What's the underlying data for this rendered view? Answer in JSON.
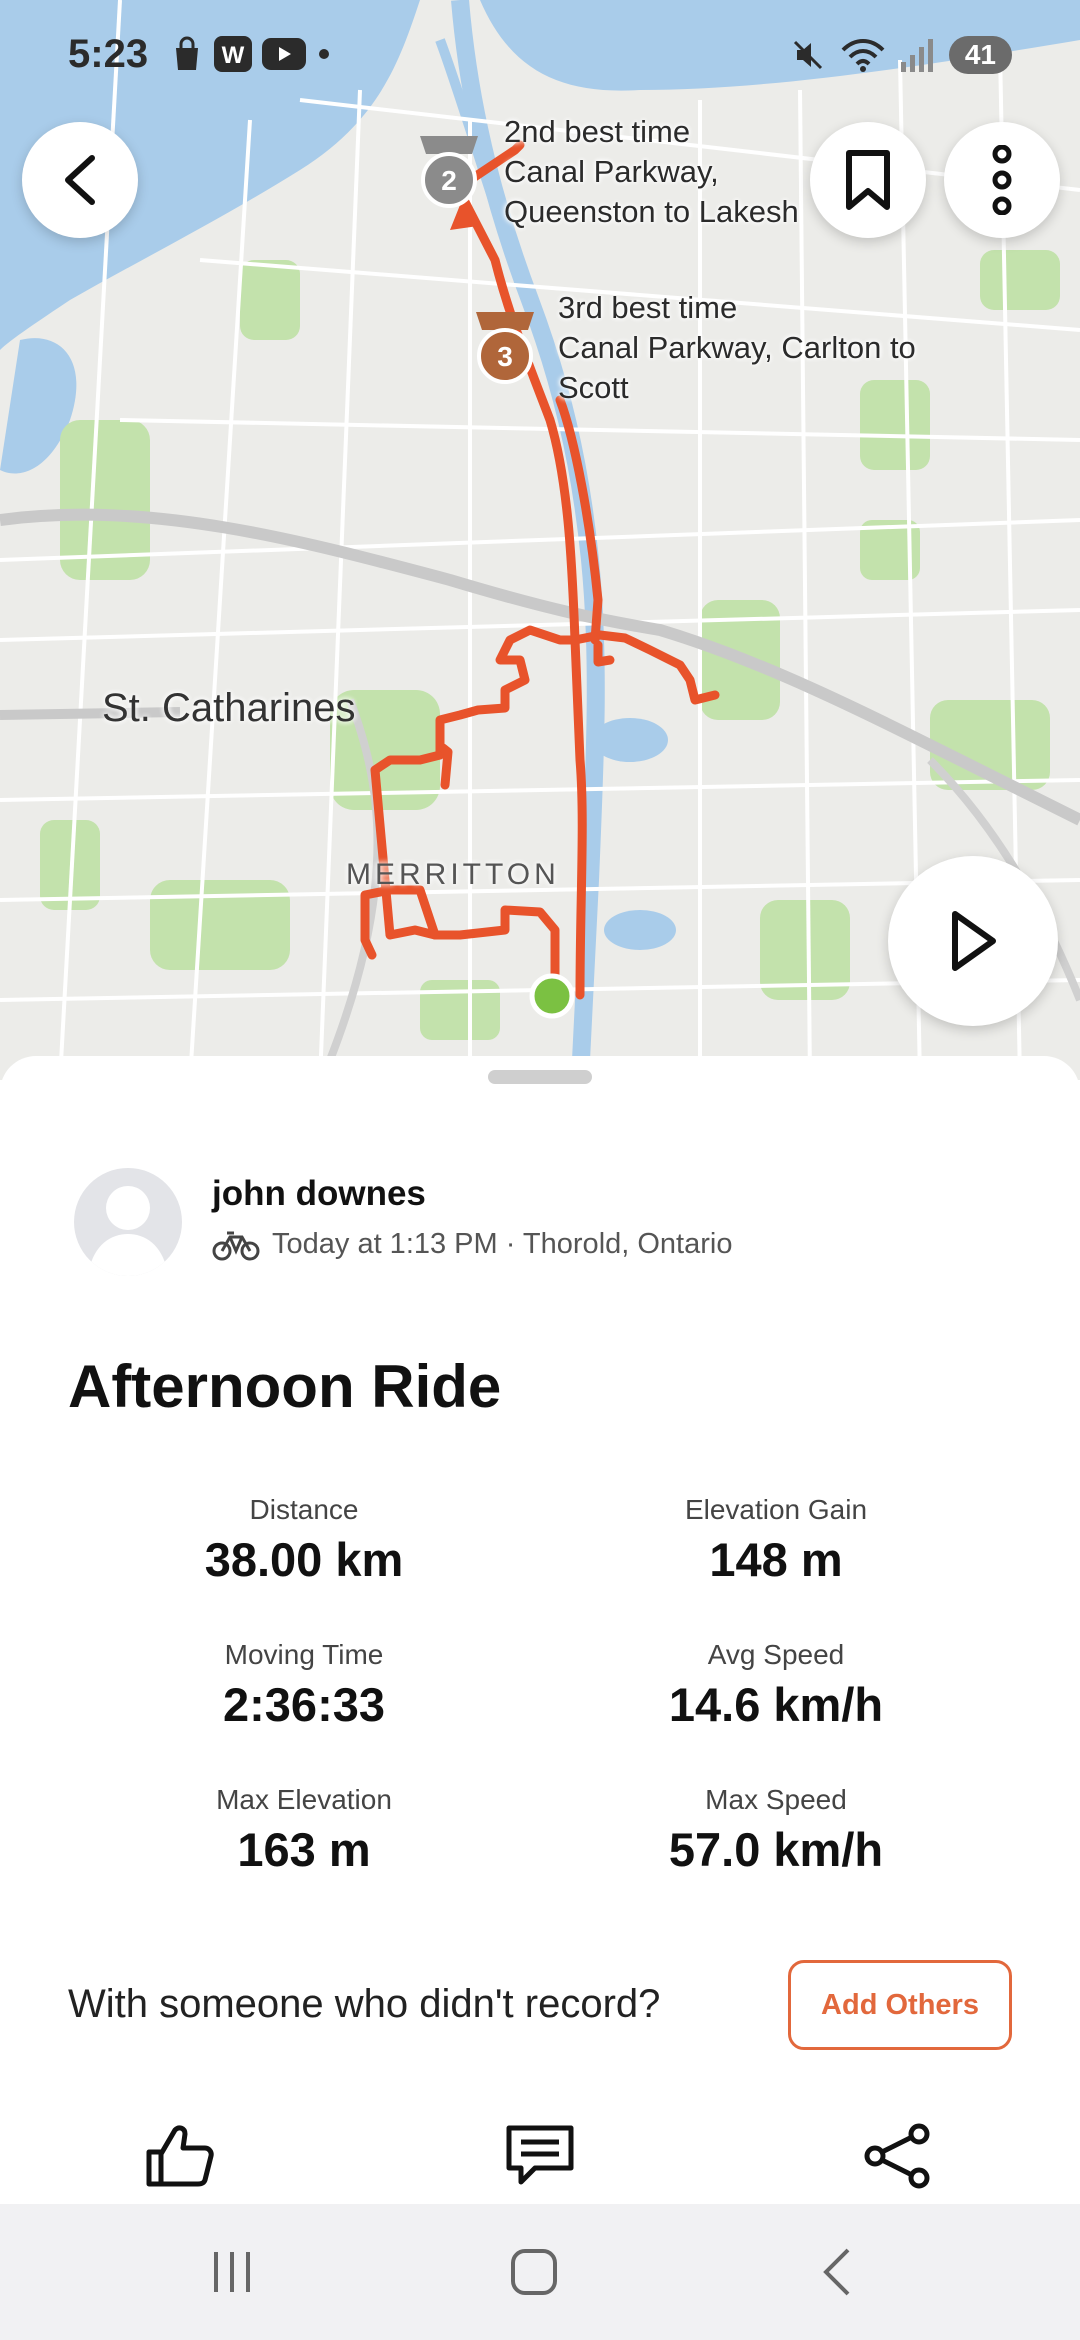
{
  "status_bar": {
    "time": "5:23",
    "battery": "41",
    "left_icons": [
      "shopping-bag-icon",
      "w-app-icon",
      "youtube-icon",
      "dot-icon"
    ],
    "right_icons": [
      "mute-icon",
      "wifi-icon",
      "signal-icon",
      "battery-icon"
    ]
  },
  "map": {
    "route_color": "#E8532B",
    "water_color": "#A9CCEB",
    "start_marker_color": "#7BC142",
    "places": {
      "city": "St. Catharines",
      "district": "MERRITTON"
    },
    "segments": [
      {
        "rank": "2",
        "title": "2nd best time",
        "line1": "Canal Parkway,",
        "line2": "Queenston to Lakesh"
      },
      {
        "rank": "3",
        "title": "3rd best time",
        "line1": "Canal Parkway, Carlton to",
        "line2": "Scott"
      }
    ]
  },
  "activity": {
    "athlete": "john downes",
    "meta": "Today at 1:13 PM · Thorold, Ontario",
    "title": "Afternoon Ride",
    "stats": {
      "distance": {
        "label": "Distance",
        "value": "38.00 km"
      },
      "elevation_gain": {
        "label": "Elevation Gain",
        "value": "148 m"
      },
      "moving_time": {
        "label": "Moving Time",
        "value": "2:36:33"
      },
      "avg_speed": {
        "label": "Avg Speed",
        "value": "14.6 km/h"
      },
      "max_elevation": {
        "label": "Max Elevation",
        "value": "163 m"
      },
      "max_speed": {
        "label": "Max Speed",
        "value": "57.0 km/h"
      }
    },
    "add_others_prompt": "With someone who didn't record?",
    "add_others_button": "Add Others",
    "accent_color": "#E2683C"
  }
}
